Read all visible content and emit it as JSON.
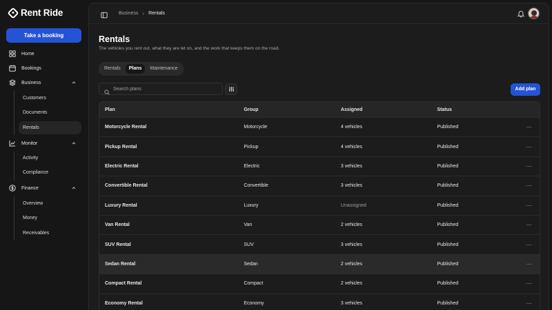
{
  "app": {
    "name": "Rent Ride"
  },
  "sidebar": {
    "cta_label": "Take a booking",
    "items": [
      {
        "label": "Home",
        "icon": "grid-icon"
      },
      {
        "label": "Bookings",
        "icon": "calendar-icon"
      },
      {
        "label": "Business",
        "icon": "layers-icon",
        "expanded": true,
        "children": [
          {
            "label": "Customers"
          },
          {
            "label": "Documents"
          },
          {
            "label": "Rentals",
            "active": true
          }
        ]
      },
      {
        "label": "Monitor",
        "icon": "chart-icon",
        "expanded": true,
        "children": [
          {
            "label": "Activity"
          },
          {
            "label": "Compliance"
          }
        ]
      },
      {
        "label": "Finance",
        "icon": "dollar-icon",
        "expanded": true,
        "children": [
          {
            "label": "Overview"
          },
          {
            "label": "Money"
          },
          {
            "label": "Receivables"
          }
        ]
      }
    ]
  },
  "header": {
    "breadcrumb": [
      "Business",
      "Rentals"
    ]
  },
  "page": {
    "title": "Rentals",
    "subtitle": "The vehicles you rent out, what they are let on, and the work that keeps them on the road."
  },
  "tabs": [
    {
      "label": "Rentals",
      "active": false
    },
    {
      "label": "Plans",
      "active": true
    },
    {
      "label": "Maintenance",
      "active": false
    }
  ],
  "toolbar": {
    "search_placeholder": "Search plans",
    "add_label": "Add plan"
  },
  "table": {
    "columns": [
      "Plan",
      "Group",
      "Assigned",
      "Status"
    ],
    "rows": [
      {
        "plan": "Motorcycle Rental",
        "group": "Motorcycle",
        "assigned": "4 vehicles",
        "status": "Published"
      },
      {
        "plan": "Pickup Rental",
        "group": "Pickup",
        "assigned": "4 vehicles",
        "status": "Published"
      },
      {
        "plan": "Electric Rental",
        "group": "Electric",
        "assigned": "3 vehicles",
        "status": "Published"
      },
      {
        "plan": "Convertible Rental",
        "group": "Convertible",
        "assigned": "3 vehicles",
        "status": "Published"
      },
      {
        "plan": "Luxury Rental",
        "group": "Luxury",
        "assigned": "Unassigned",
        "status": "Published"
      },
      {
        "plan": "Van Rental",
        "group": "Van",
        "assigned": "2 vehicles",
        "status": "Published"
      },
      {
        "plan": "SUV Rental",
        "group": "SUV",
        "assigned": "3 vehicles",
        "status": "Published"
      },
      {
        "plan": "Sedan Rental",
        "group": "Sedan",
        "assigned": "2 vehicles",
        "status": "Published",
        "highlighted": true
      },
      {
        "plan": "Compact Rental",
        "group": "Compact",
        "assigned": "2 vehicles",
        "status": "Published"
      },
      {
        "plan": "Economy Rental",
        "group": "Economy",
        "assigned": "3 vehicles",
        "status": "Published"
      }
    ],
    "row_action_glyph": "···"
  },
  "colors": {
    "accent": "#2553d8",
    "background": "#161616",
    "panel": "#1c1c1c"
  }
}
